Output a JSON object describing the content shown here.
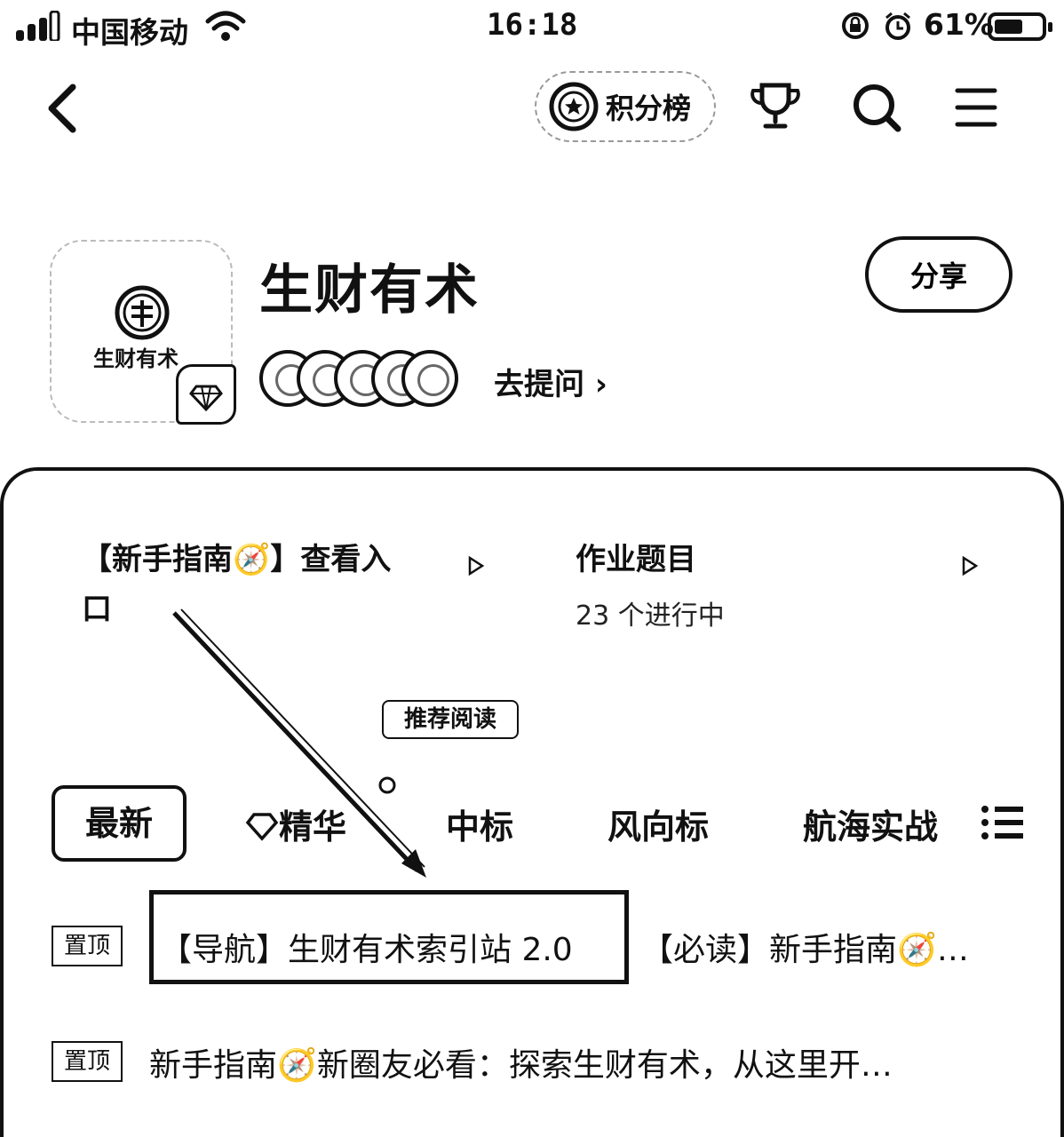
{
  "status_bar": {
    "carrier": "中国移动",
    "time": "16:18",
    "battery_percent": "61%",
    "battery_level": 0.61,
    "icons": [
      "signal-icon",
      "wifi-icon",
      "screen-lock-icon",
      "alarm-icon",
      "battery-icon"
    ]
  },
  "nav": {
    "ranking_label": "积分榜",
    "icons": [
      "back-icon",
      "ranking-badge-icon",
      "trophy-icon",
      "search-icon",
      "menu-icon"
    ]
  },
  "circle": {
    "name": "生财有术",
    "logo_text": "生财有术",
    "share_label": "分享",
    "ask_label": "去提问 ›",
    "avatar_count": 5
  },
  "entries": [
    {
      "title": "【新手指南🧭】查看入口",
      "line1": "【新手指南🧭】查看入",
      "line2": "口"
    },
    {
      "title": "作业题目",
      "subtitle": "23 个进行中"
    }
  ],
  "recommend_badge": "推荐阅读",
  "tabs": [
    {
      "label": "最新",
      "active": true
    },
    {
      "label": "精华",
      "icon": "diamond-icon"
    },
    {
      "label": "中标"
    },
    {
      "label": "风向标"
    },
    {
      "label": "航海实战"
    }
  ],
  "pinned": [
    {
      "tag": "置顶",
      "items": [
        "【导航】生财有术索引站 2.0",
        "【必读】新手指南🧭…"
      ]
    },
    {
      "tag": "置顶",
      "items": [
        "新手指南🧭新圈友必看：探索生财有术，从这里开…"
      ]
    }
  ]
}
